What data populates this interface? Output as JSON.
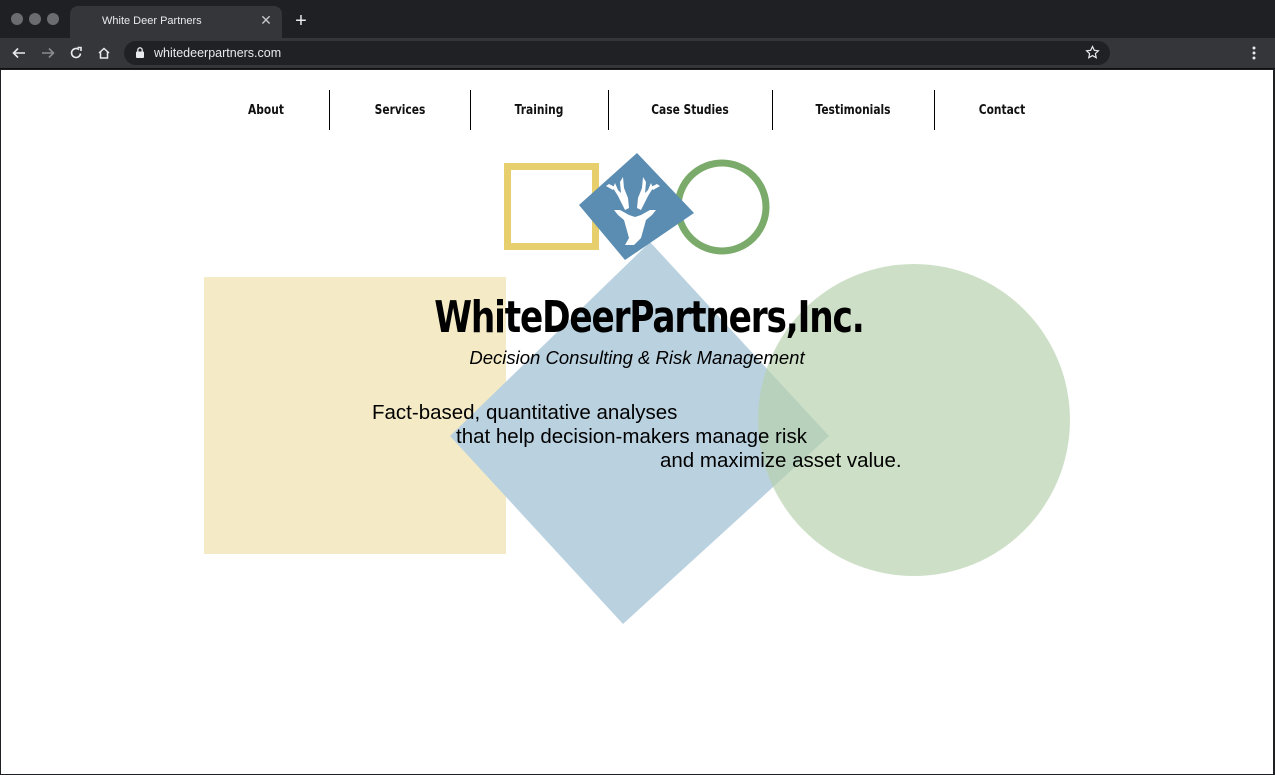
{
  "browser": {
    "tab_title": "White Deer Partners",
    "tab_close_icon": "close-icon",
    "new_tab_icon": "plus-icon",
    "url": "whitedeerpartners.com"
  },
  "site": {
    "menu": [
      "About",
      "Services",
      "Training",
      "Case Studies",
      "Testimonials",
      "Contact"
    ],
    "brand": "WhiteDeerPartners,Inc.",
    "tagline": "Decision Consulting & Risk Management",
    "lead_lines": [
      "Fact-based, quantitative analyses",
      "that help decision-makers manage risk",
      "and maximize asset value."
    ],
    "colors": {
      "yellow": "#e6cf6c",
      "yellow_light": "#f4ebc6",
      "blue": "#5b8db3",
      "blue_light": "#b9d0df",
      "green": "#7aab6a",
      "green_light": "#cadfc5"
    },
    "logo_icon": "deer-head-icon"
  }
}
